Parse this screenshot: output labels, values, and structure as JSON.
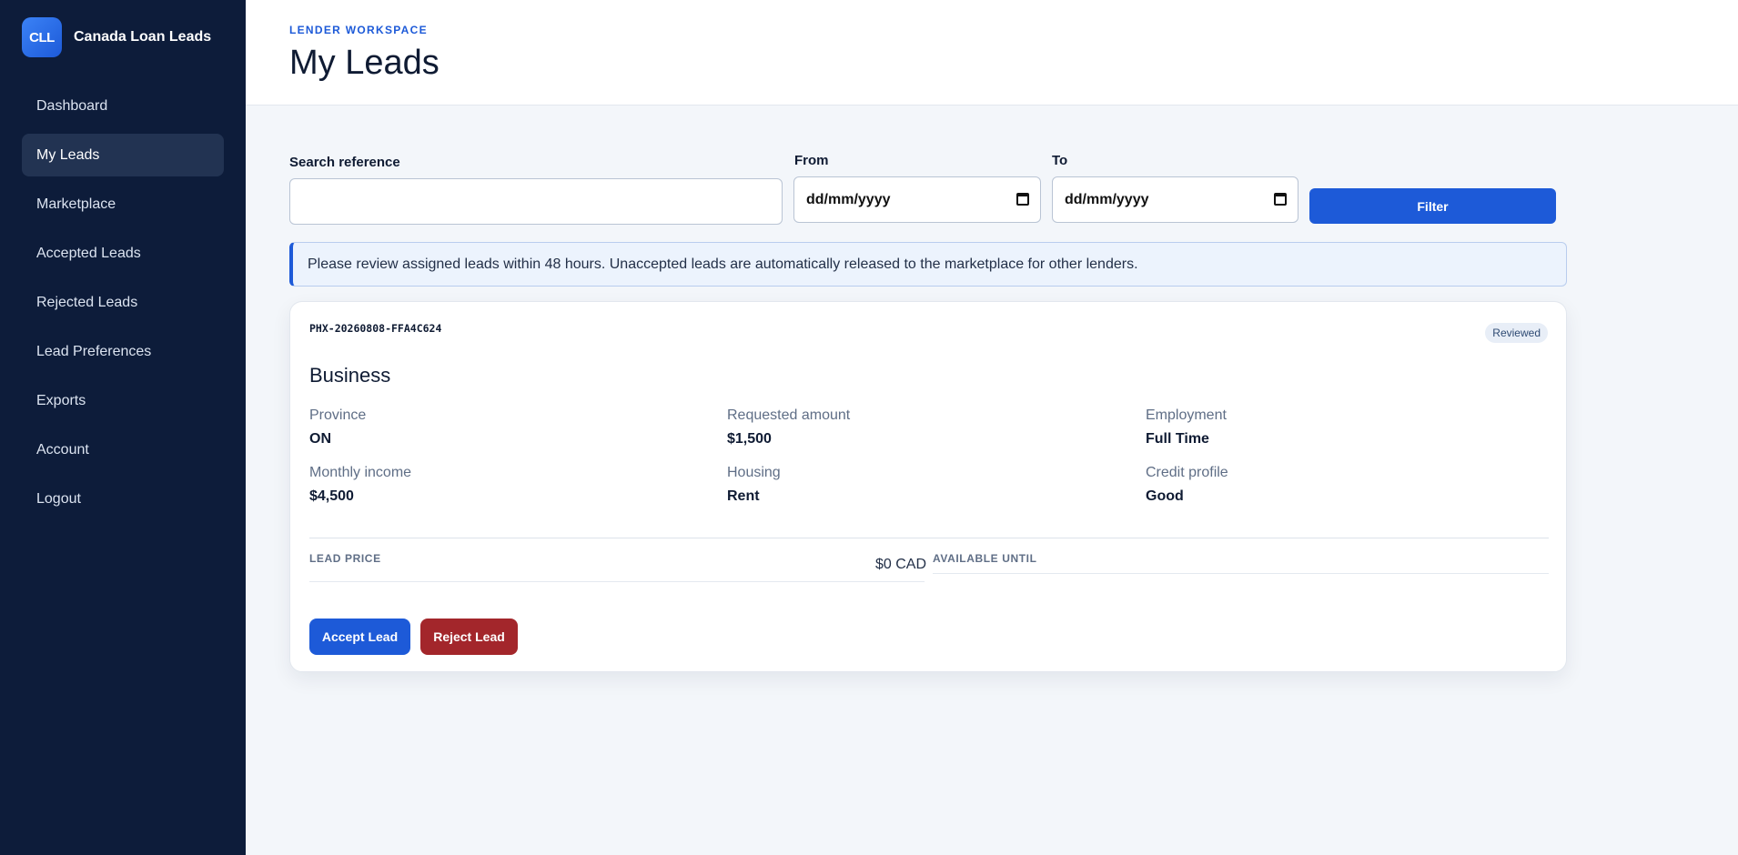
{
  "brand": {
    "logo_text": "CLL",
    "name": "Canada Loan Leads"
  },
  "sidebar": {
    "items": [
      {
        "label": "Dashboard",
        "active": false
      },
      {
        "label": "My Leads",
        "active": true
      },
      {
        "label": "Marketplace",
        "active": false
      },
      {
        "label": "Accepted Leads",
        "active": false
      },
      {
        "label": "Rejected Leads",
        "active": false
      },
      {
        "label": "Lead Preferences",
        "active": false
      },
      {
        "label": "Exports",
        "active": false
      },
      {
        "label": "Account",
        "active": false
      },
      {
        "label": "Logout",
        "active": false
      }
    ]
  },
  "header": {
    "eyebrow": "LENDER WORKSPACE",
    "title": "My Leads"
  },
  "filters": {
    "search_label": "Search reference",
    "search_value": "",
    "from_label": "From",
    "from_value": "dd/mm/yyyy",
    "to_label": "To",
    "to_value": "dd/mm/yyyy",
    "filter_button": "Filter"
  },
  "notice": "Please review assigned leads within 48 hours. Unaccepted leads are automatically released to the marketplace for other lenders.",
  "lead": {
    "reference": "PHX-20260808-FFA4C624",
    "status": "Reviewed",
    "category": "Business",
    "fields": [
      {
        "label": "Province",
        "value": "ON"
      },
      {
        "label": "Requested amount",
        "value": "$1,500"
      },
      {
        "label": "Employment",
        "value": "Full Time"
      },
      {
        "label": "Monthly income",
        "value": "$4,500"
      },
      {
        "label": "Housing",
        "value": "Rent"
      },
      {
        "label": "Credit profile",
        "value": "Good"
      }
    ],
    "price_label": "LEAD PRICE",
    "price_value": "$0 CAD",
    "available_label": "AVAILABLE UNTIL",
    "available_value": "",
    "accept_button": "Accept Lead",
    "reject_button": "Reject Lead"
  },
  "colors": {
    "sidebar_bg": "#0d1c3a",
    "accent": "#1d5ad8",
    "danger": "#a3262b",
    "page_bg": "#f3f6fa"
  }
}
